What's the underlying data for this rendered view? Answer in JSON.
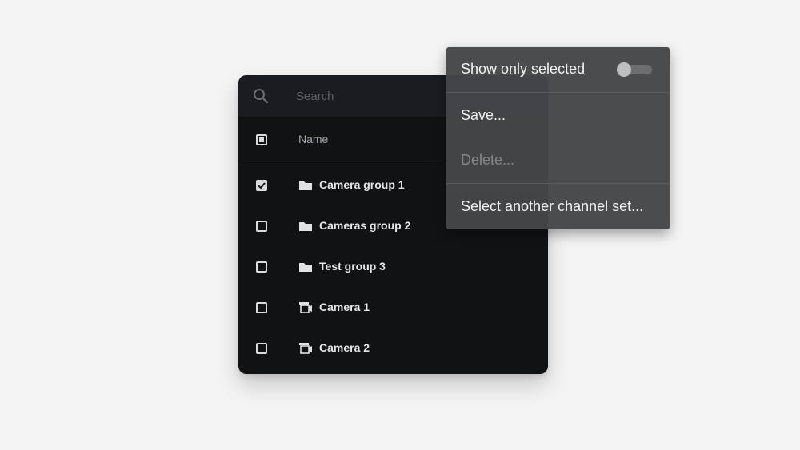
{
  "search": {
    "placeholder": "Search"
  },
  "table": {
    "header_label": "Name",
    "rows": [
      {
        "label": "Camera group 1",
        "icon": "folder-icon",
        "checked": true
      },
      {
        "label": "Cameras group 2",
        "icon": "folder-icon",
        "checked": false
      },
      {
        "label": "Test group 3",
        "icon": "folder-icon",
        "checked": false
      },
      {
        "label": "Camera 1",
        "icon": "camera-icon",
        "checked": false
      },
      {
        "label": "Camera 2",
        "icon": "camera-icon",
        "checked": false
      }
    ]
  },
  "menu": {
    "show_only_selected": {
      "label": "Show only selected",
      "enabled": false
    },
    "save": "Save...",
    "delete": "Delete...",
    "select_set": "Select another channel set..."
  },
  "colors": {
    "panel_bg": "#111214",
    "menu_bg": "#444648",
    "text": "#e6e7e9",
    "disabled_text": "#84878b"
  }
}
